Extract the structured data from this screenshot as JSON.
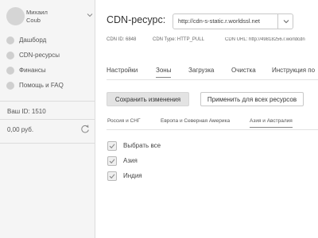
{
  "sidebar": {
    "user": {
      "name": "Михаил",
      "sub": "Coub"
    },
    "items": [
      {
        "label": "Дашборд",
        "icon": "dashboard-icon"
      },
      {
        "label": "CDN-ресурсы",
        "icon": "cdn-icon"
      },
      {
        "label": "Финансы",
        "icon": "finance-icon"
      },
      {
        "label": "Помощь и FAQ",
        "icon": "help-icon"
      }
    ],
    "account_id": "Ваш ID: 1510",
    "balance": "0,00 руб."
  },
  "header": {
    "title": "CDN-ресурс:",
    "url": "http://cdn-s-static.r.worldssl.net"
  },
  "meta": {
    "cdn_id": "CDN ID: 6848",
    "cdn_type": "CDN Type: HTTP_PULL",
    "cdn_url": "CDN URL: http://49818256.r.worldcdn"
  },
  "tabs": [
    {
      "label": "Настройки"
    },
    {
      "label": "Зоны"
    },
    {
      "label": "Загрузка"
    },
    {
      "label": "Очистка"
    },
    {
      "label": "Инструкция по"
    }
  ],
  "active_tab": "Зоны",
  "buttons": {
    "save": "Сохранить изменения",
    "apply_all": "Применить для всех ресурсов"
  },
  "subtabs": [
    {
      "label": "Россия и СНГ"
    },
    {
      "label": "Европа и Северная Америка"
    },
    {
      "label": "Азия и Австралия"
    }
  ],
  "active_subtab": "Азия и Австралия",
  "checklist": [
    {
      "label": "Выбрать все",
      "checked": true
    },
    {
      "label": "Азия",
      "checked": true
    },
    {
      "label": "Индия",
      "checked": true
    }
  ],
  "colors": {
    "sidebar_bg": "#f5f5f5",
    "icon_gray": "#cfcfcf",
    "button_gray": "#e3e3e3",
    "border": "#c8c8c8"
  }
}
